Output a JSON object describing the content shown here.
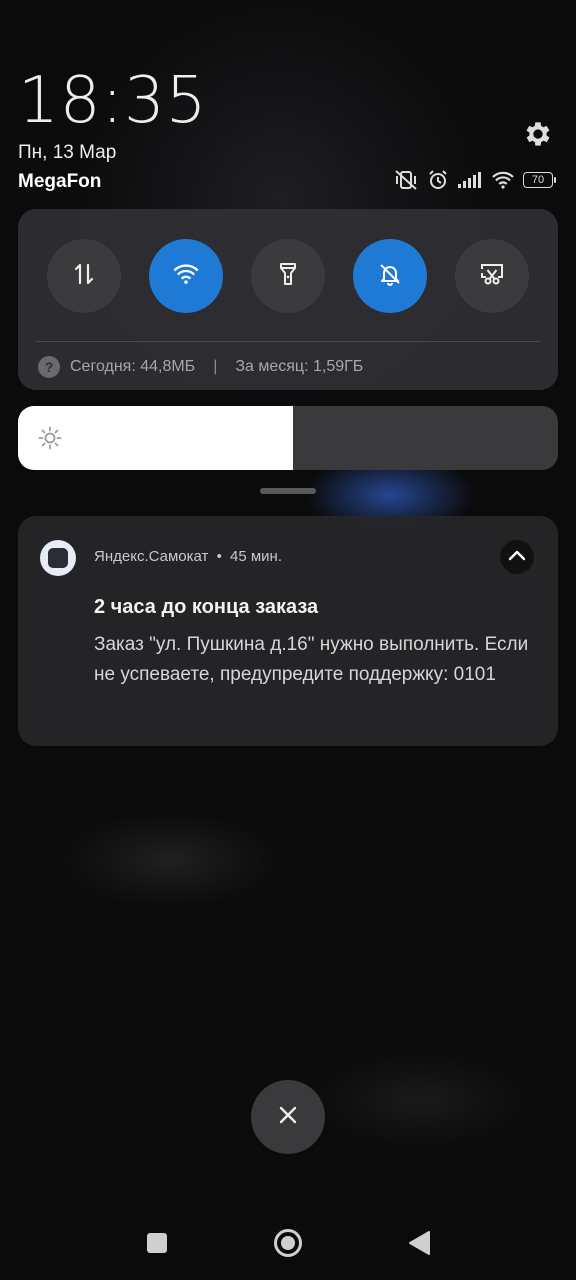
{
  "lockscreen": {
    "time": "18:35",
    "date": "Пн, 13 Мар",
    "carrier": "MegaFon"
  },
  "status_bar": {
    "icons": [
      "vibrate-off-icon",
      "alarm-icon",
      "signal-icon",
      "wifi-icon",
      "battery-icon"
    ],
    "battery_level": "70"
  },
  "quick_settings": {
    "tiles": [
      {
        "name": "mobile-data-icon",
        "active": false
      },
      {
        "name": "wifi-icon",
        "active": true
      },
      {
        "name": "flashlight-icon",
        "active": false
      },
      {
        "name": "mute-bell-icon",
        "active": true
      },
      {
        "name": "screenshot-icon",
        "active": false
      }
    ],
    "usage_today": "Сегодня: 44,8МБ",
    "usage_separator": "|",
    "usage_month": "За месяц: 1,59ГБ"
  },
  "brightness": {
    "level": 0.51
  },
  "notification": {
    "app_name": "Яндекс.Самокат",
    "dot": "•",
    "time_ago": "45 мин.",
    "title": "2 часа до конца заказа",
    "body": "Заказ \"ул. Пушкина д.16\" нужно выполнить. Если не успеваете, предупредите поддержку: 0101"
  },
  "colors": {
    "accent": "#1f7ad6",
    "tile_off": "#3b3b3e",
    "panel": "#303034"
  }
}
